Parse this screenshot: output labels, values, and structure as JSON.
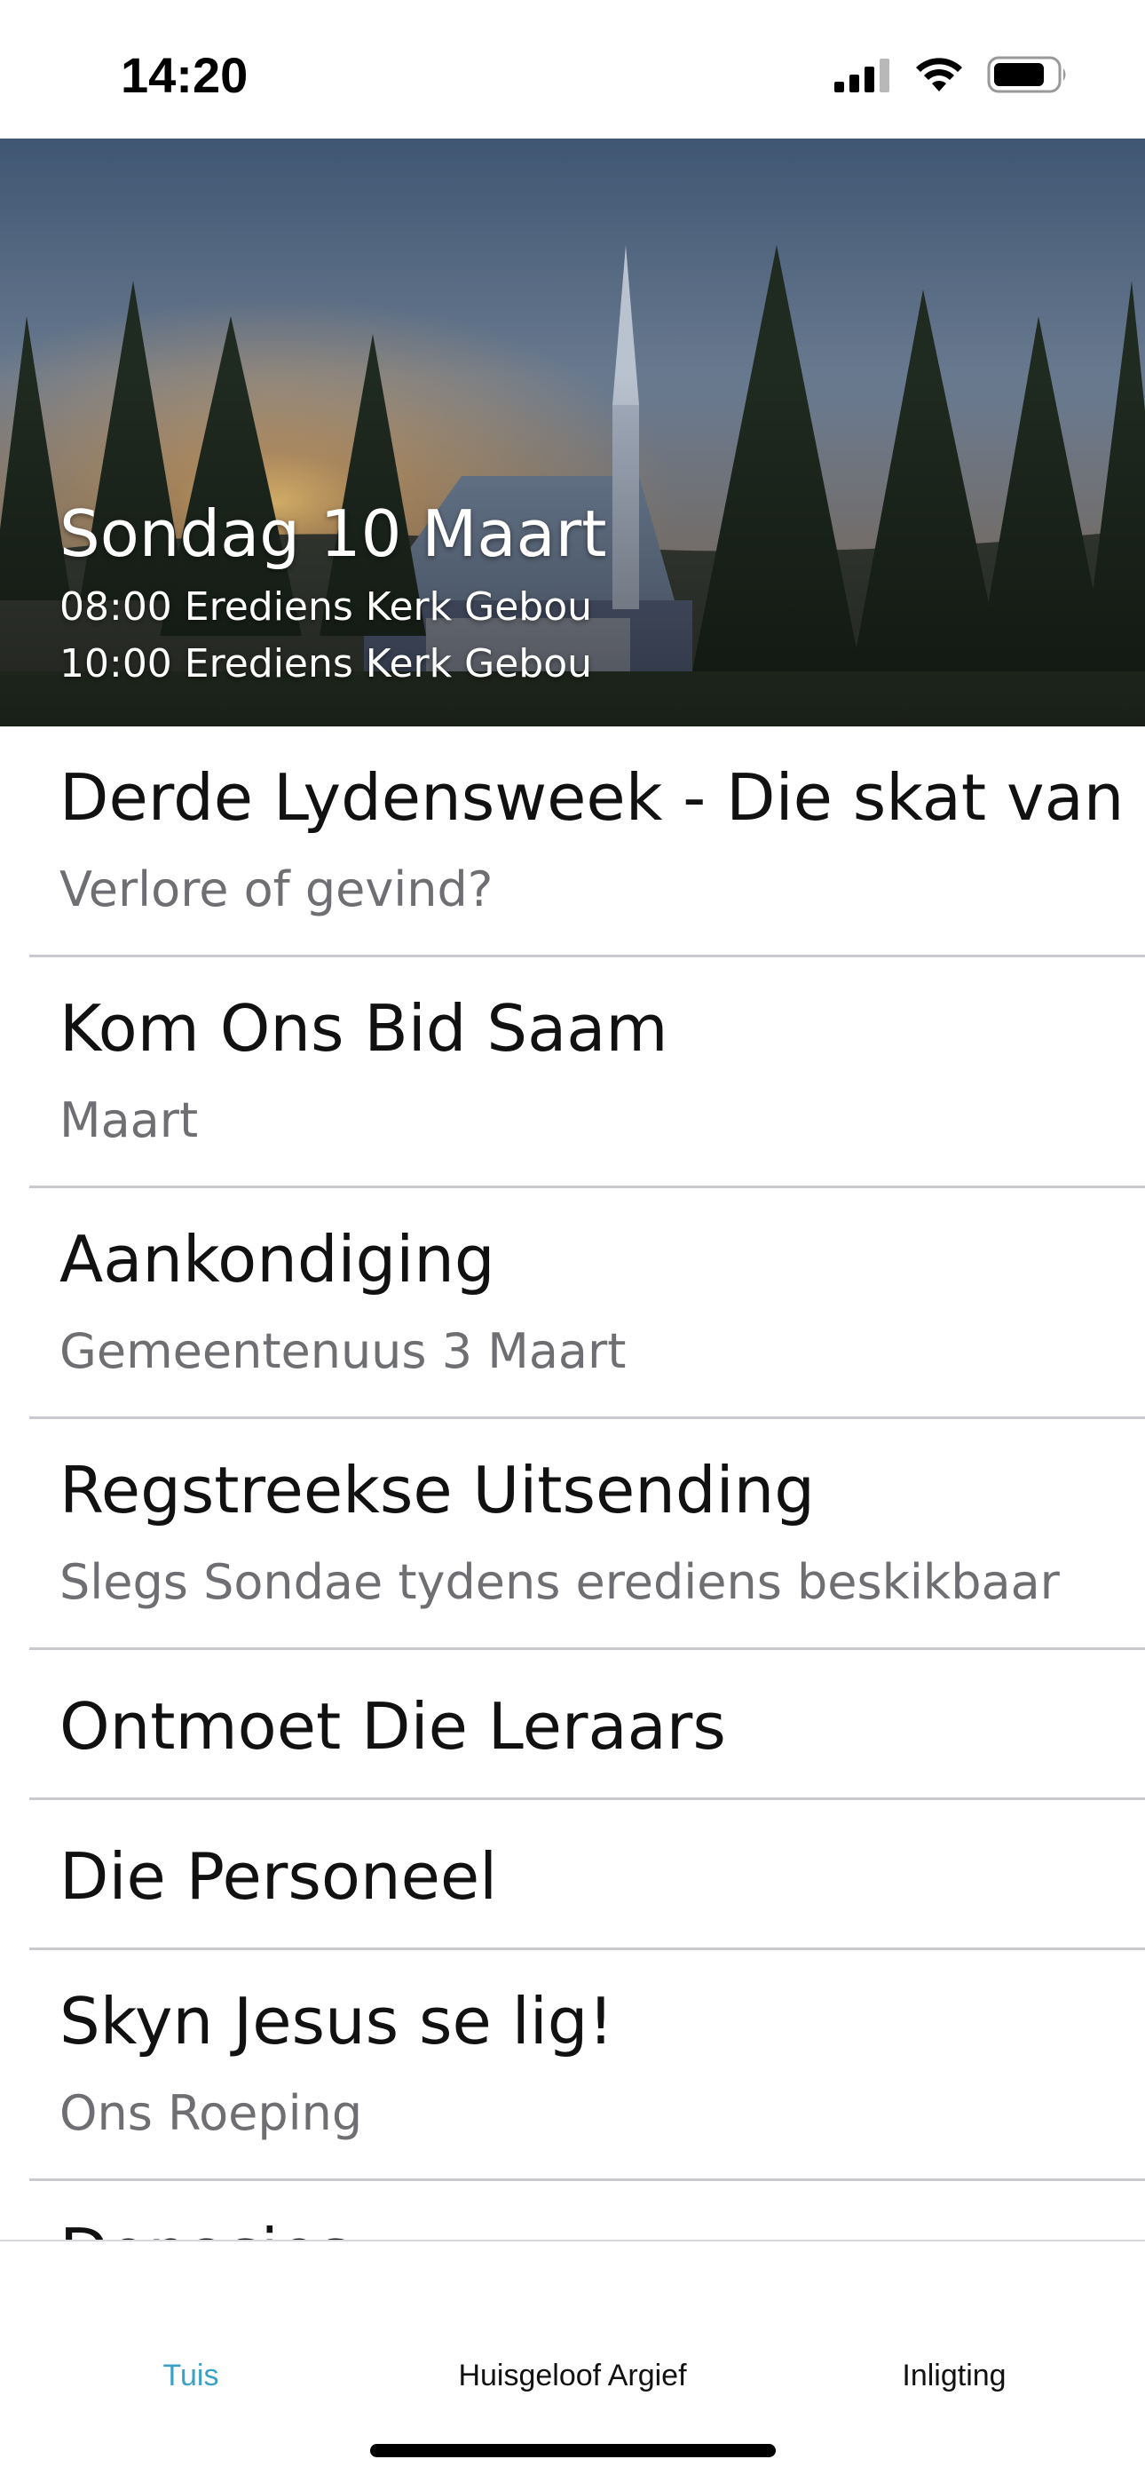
{
  "status_bar": {
    "time": "14:20"
  },
  "hero": {
    "title": "Sondag 10 Maart",
    "services": [
      "08:00 Erediens Kerk Gebou",
      "10:00 Erediens Kerk Gebou"
    ]
  },
  "list": {
    "items": [
      {
        "title": "Derde Lydensweek - Die skat van die",
        "subtitle": "Verlore of gevind?"
      },
      {
        "title": "Kom Ons Bid Saam",
        "subtitle": "Maart"
      },
      {
        "title": "Aankondiging",
        "subtitle": "Gemeentenuus 3 Maart"
      },
      {
        "title": "Regstreekse Uitsending",
        "subtitle": "Slegs Sondae tydens erediens beskikbaar"
      },
      {
        "title": "Ontmoet Die Leraars"
      },
      {
        "title": "Die Personeel"
      },
      {
        "title": "Skyn Jesus se lig!",
        "subtitle": "Ons Roeping"
      },
      {
        "title": "Donasies"
      }
    ]
  },
  "tab_bar": {
    "tabs": [
      {
        "label": "Tuis",
        "active": true
      },
      {
        "label": "Huisgeloof Argief",
        "active": false
      },
      {
        "label": "Inligting",
        "active": false
      }
    ]
  },
  "colors": {
    "accent": "#3aa0c6",
    "subtitle": "#6e6e73",
    "divider": "#c9c9ce"
  }
}
